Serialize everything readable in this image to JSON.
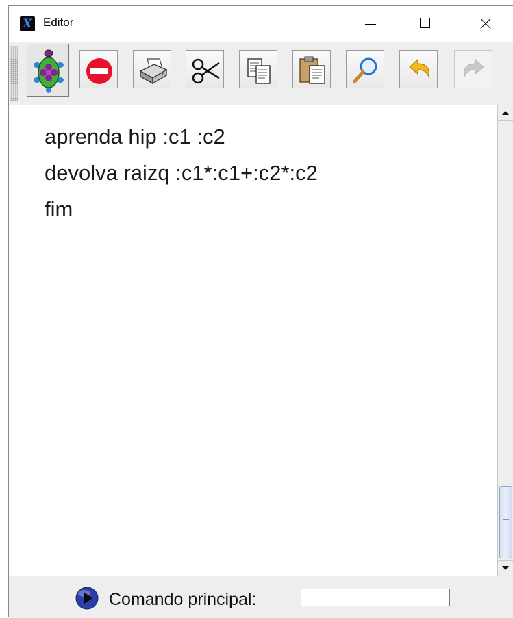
{
  "window": {
    "title": "Editor",
    "app_icon_glyph": "X"
  },
  "toolbar": {
    "buttons": [
      {
        "name": "turtle-icon",
        "state": "pressed"
      },
      {
        "name": "stop-icon"
      },
      {
        "name": "printer-icon"
      },
      {
        "name": "scissors-icon"
      },
      {
        "name": "copy-icon"
      },
      {
        "name": "paste-icon"
      },
      {
        "name": "magnifier-icon"
      },
      {
        "name": "undo-icon"
      },
      {
        "name": "redo-icon",
        "state": "disabled"
      }
    ]
  },
  "editor": {
    "lines": [
      "aprenda hip :c1 :c2",
      "devolva raizq :c1*:c1+:c2*:c2",
      "fim"
    ]
  },
  "bottom": {
    "command_label": "Comando principal:",
    "command_value": ""
  },
  "colors": {
    "stop_red": "#e8112d",
    "run_blue": "#2a3fa8",
    "undo_yellow": "#f2b81c"
  }
}
